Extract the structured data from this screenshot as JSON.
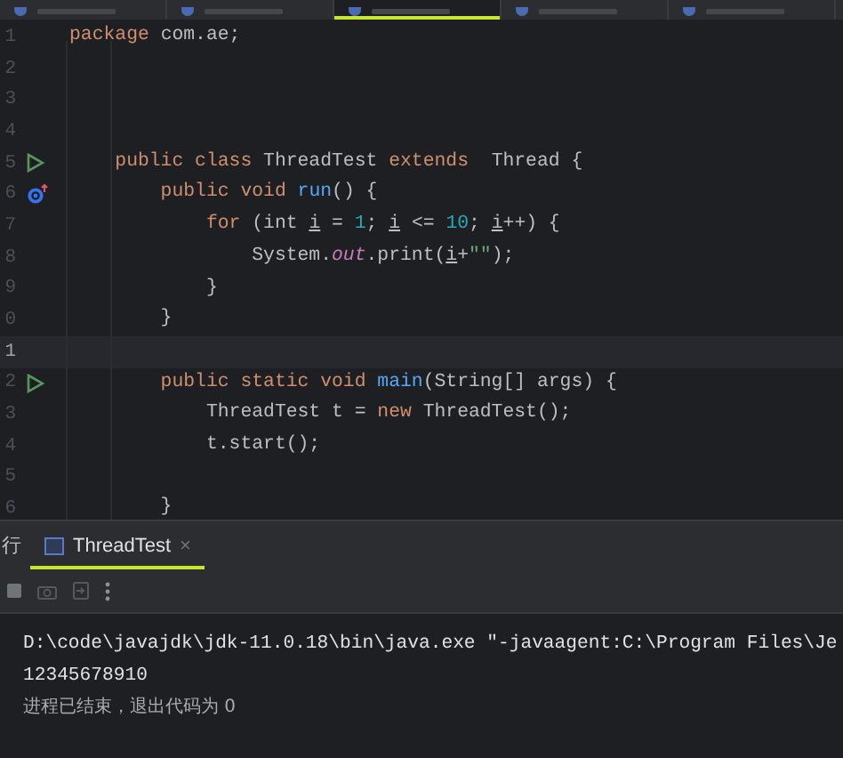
{
  "editor_tabs": [
    {
      "selected": false
    },
    {
      "selected": false
    },
    {
      "selected": true
    },
    {
      "selected": false
    },
    {
      "selected": false
    }
  ],
  "lines": [
    {
      "number": "1",
      "current": false,
      "tokens": [
        {
          "t": "package ",
          "kind": "kw"
        },
        {
          "t": "com.ae;",
          "kind": "plain"
        }
      ]
    },
    {
      "number": "2",
      "current": false
    },
    {
      "number": "3",
      "current": false
    },
    {
      "number": "4",
      "current": false
    },
    {
      "number": "5",
      "current": false,
      "gutter": {
        "kind": "run"
      },
      "tokens": [
        {
          "t": "    public class ",
          "kind": "kw"
        },
        {
          "t": "ThreadTest ",
          "kind": "plain"
        },
        {
          "t": "extends ",
          "kind": "kw"
        },
        {
          "t": " Thread {",
          "kind": "plain"
        }
      ]
    },
    {
      "number": "6",
      "current": false,
      "gutter": {
        "kind": "override"
      },
      "tokens": [
        {
          "t": "        public void ",
          "kind": "kw"
        },
        {
          "t": "run",
          "kind": "method"
        },
        {
          "t": "() {",
          "kind": "plain"
        }
      ]
    },
    {
      "number": "7",
      "current": false,
      "tokens": [
        {
          "t": "            for ",
          "kind": "kw"
        },
        {
          "t": "(int ",
          "kind": "plain"
        },
        {
          "t": "i",
          "kind": "var"
        },
        {
          "t": " = ",
          "kind": "plain"
        },
        {
          "t": "1",
          "kind": "num"
        },
        {
          "t": "; ",
          "kind": "plain"
        },
        {
          "t": "i",
          "kind": "var"
        },
        {
          "t": " <= ",
          "kind": "plain"
        },
        {
          "t": "10",
          "kind": "num"
        },
        {
          "t": "; ",
          "kind": "plain"
        },
        {
          "t": "i",
          "kind": "var"
        },
        {
          "t": "++) {",
          "kind": "plain"
        }
      ]
    },
    {
      "number": "8",
      "current": false,
      "tokens": [
        {
          "t": "                System.",
          "kind": "plain"
        },
        {
          "t": "out",
          "kind": "field"
        },
        {
          "t": ".print(",
          "kind": "plain"
        },
        {
          "t": "i",
          "kind": "var"
        },
        {
          "t": "+",
          "kind": "plain"
        },
        {
          "t": "\"\"",
          "kind": "str"
        },
        {
          "t": ");",
          "kind": "plain"
        }
      ]
    },
    {
      "number": "9",
      "current": false,
      "tokens": [
        {
          "t": "            }",
          "kind": "plain"
        }
      ]
    },
    {
      "number": "0",
      "current": false,
      "tokens": [
        {
          "t": "        }",
          "kind": "plain"
        }
      ]
    },
    {
      "number": "1",
      "current": true
    },
    {
      "number": "2",
      "current": false,
      "gutter": {
        "kind": "run"
      },
      "tokens": [
        {
          "t": "        public static void ",
          "kind": "kw"
        },
        {
          "t": "main",
          "kind": "method"
        },
        {
          "t": "(String[] args) {",
          "kind": "plain"
        }
      ]
    },
    {
      "number": "3",
      "current": false,
      "tokens": [
        {
          "t": "            ThreadTest t = ",
          "kind": "plain"
        },
        {
          "t": "new ",
          "kind": "kw"
        },
        {
          "t": "ThreadTest();",
          "kind": "plain"
        }
      ]
    },
    {
      "number": "4",
      "current": false,
      "tokens": [
        {
          "t": "            t.start();",
          "kind": "plain"
        }
      ]
    },
    {
      "number": "5",
      "current": false
    },
    {
      "number": "6",
      "current": false,
      "tokens": [
        {
          "t": "        }",
          "kind": "plain"
        }
      ]
    }
  ],
  "run_panel": {
    "title_fragment": "行",
    "tabs": [
      {
        "label": "ThreadTest",
        "close": "×",
        "selected": true
      }
    ],
    "console": [
      {
        "text": "D:\\code\\javajdk\\jdk-11.0.18\\bin\\java.exe \"-javaagent:C:\\Program Files\\Je",
        "kind": "command"
      },
      {
        "text": "12345678910",
        "kind": "output"
      },
      {
        "text": "进程已结束，退出代码为 0",
        "kind": "status"
      }
    ]
  }
}
